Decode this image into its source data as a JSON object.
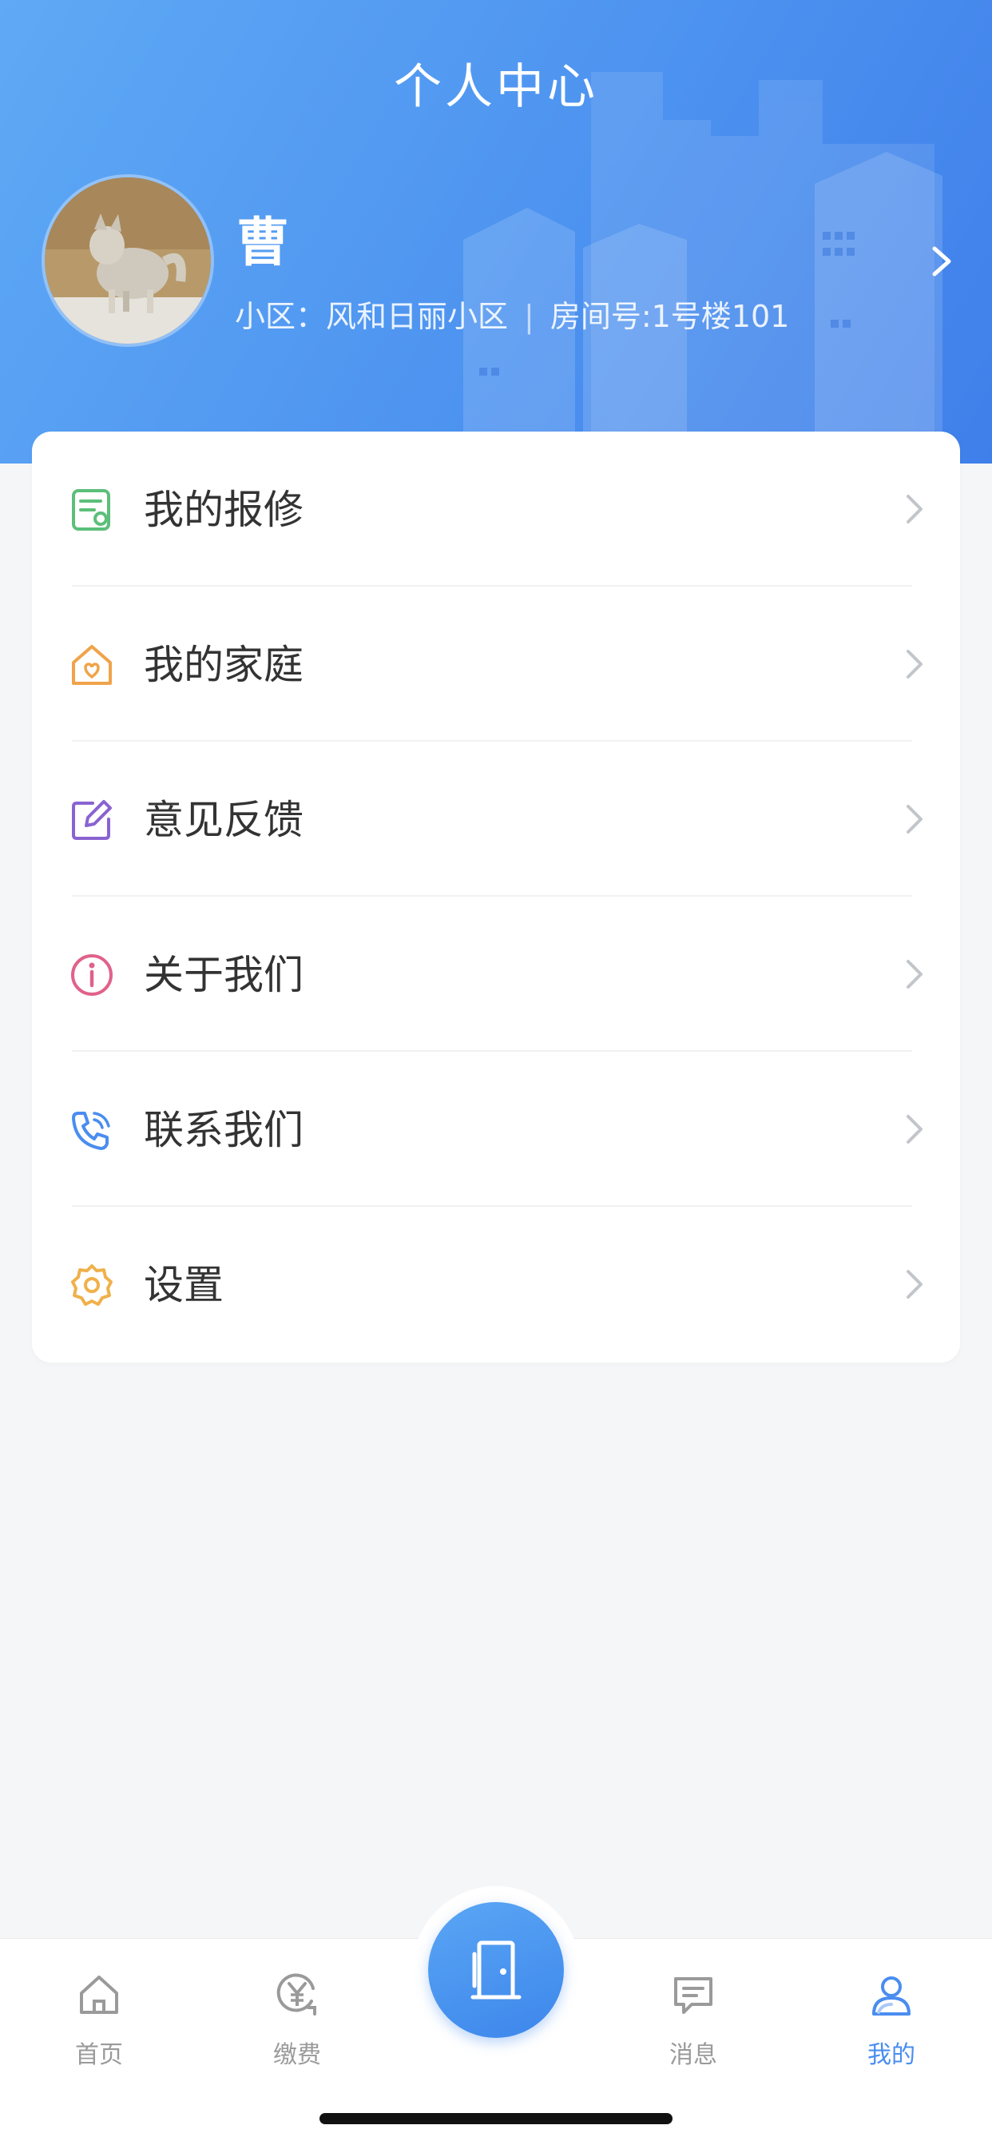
{
  "header": {
    "title": "个人中心",
    "user_name": "曹",
    "community_label": "小区：风和日丽小区",
    "room_label": "房间号:1号楼101"
  },
  "menu": [
    {
      "label": "我的报修",
      "icon": "repair-list-icon",
      "color": "#5cbf7a"
    },
    {
      "label": "我的家庭",
      "icon": "home-heart-icon",
      "color": "#f0a34a"
    },
    {
      "label": "意见反馈",
      "icon": "edit-feedback-icon",
      "color": "#8a63d2"
    },
    {
      "label": "关于我们",
      "icon": "info-circle-icon",
      "color": "#e0628a"
    },
    {
      "label": "联系我们",
      "icon": "phone-icon",
      "color": "#4a8df0"
    },
    {
      "label": "设置",
      "icon": "gear-icon",
      "color": "#f0b04a"
    }
  ],
  "tabbar": {
    "tabs": [
      {
        "label": "首页",
        "icon": "home-icon"
      },
      {
        "label": "缴费",
        "icon": "yen-pay-icon"
      },
      {
        "label": "消息",
        "icon": "message-icon"
      },
      {
        "label": "我的",
        "icon": "user-icon",
        "active": true
      }
    ],
    "center_icon": "door-icon"
  },
  "colors": {
    "header_gradient_start": "#5fa9f5",
    "header_gradient_end": "#3f7fea",
    "accent": "#4a8df0",
    "page_background": "#f5f6f8"
  }
}
